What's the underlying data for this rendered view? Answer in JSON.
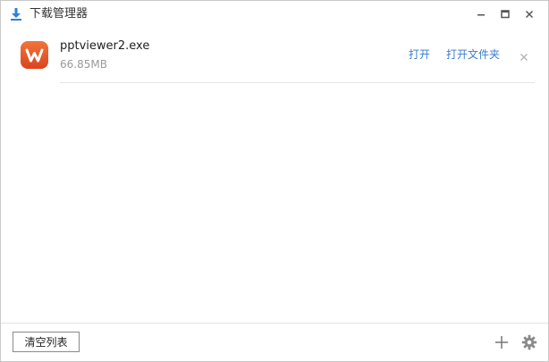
{
  "window": {
    "title": "下载管理器",
    "icon": "download-arrow-icon",
    "controls": [
      "minimize-icon",
      "maximize-icon",
      "close-icon"
    ]
  },
  "downloads": [
    {
      "file_name": "pptviewer2.exe",
      "file_size": "66.85MB",
      "icon": "wps-logo-icon",
      "open_label": "打开",
      "open_folder_label": "打开文件夹",
      "remove_icon": "close-icon"
    }
  ],
  "footer": {
    "clear_label": "清空列表",
    "add_icon": "plus-icon",
    "settings_icon": "gear-icon"
  },
  "colors": {
    "link": "#3a7ccf",
    "accent_blue": "#2f80d6",
    "wps_orange": "#e8572b",
    "border": "#c9c9c9"
  }
}
